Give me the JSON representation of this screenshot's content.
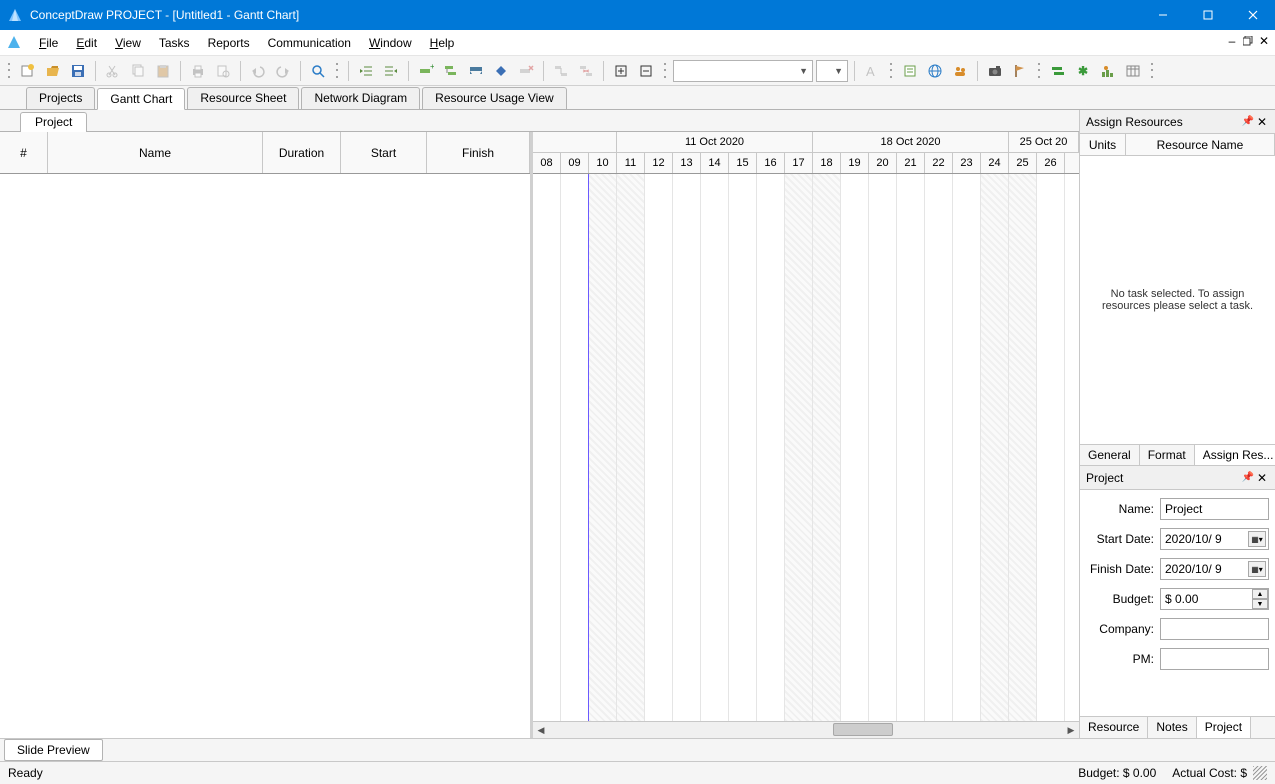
{
  "title": "ConceptDraw PROJECT - [Untitled1 - Gantt Chart]",
  "menu": {
    "file": "File",
    "edit": "Edit",
    "view": "View",
    "tasks": "Tasks",
    "reports": "Reports",
    "communication": "Communication",
    "window": "Window",
    "help": "Help"
  },
  "viewtabs": {
    "projects": "Projects",
    "gantt": "Gantt Chart",
    "resource_sheet": "Resource Sheet",
    "network": "Network Diagram",
    "resource_usage": "Resource Usage View"
  },
  "doc_tab": "Project",
  "gantt_cols": {
    "num": "#",
    "name": "Name",
    "duration": "Duration",
    "start": "Start",
    "finish": "Finish"
  },
  "weeks": [
    "11 Oct 2020",
    "18 Oct 2020",
    "25 Oct 20"
  ],
  "days": [
    "08",
    "09",
    "10",
    "11",
    "12",
    "13",
    "14",
    "15",
    "16",
    "17",
    "18",
    "19",
    "20",
    "21",
    "22",
    "23",
    "24",
    "25",
    "26"
  ],
  "assign": {
    "title": "Assign Resources",
    "units": "Units",
    "rname": "Resource Name",
    "empty": "No task selected. To assign resources please select a task."
  },
  "proptabs": {
    "general": "General",
    "format": "Format",
    "assign": "Assign Res..."
  },
  "project_panel": {
    "title": "Project",
    "name_label": "Name:",
    "name_value": "Project",
    "start_label": "Start Date:",
    "start_value": "2020/10/ 9",
    "finish_label": "Finish Date:",
    "finish_value": "2020/10/ 9",
    "budget_label": "Budget:",
    "budget_value": "$ 0.00",
    "company_label": "Company:",
    "company_value": "",
    "pm_label": "PM:",
    "pm_value": ""
  },
  "bottom_tabs": {
    "resource": "Resource",
    "notes": "Notes",
    "project": "Project"
  },
  "slide_preview": "Slide Preview",
  "status": {
    "ready": "Ready",
    "budget": "Budget: $ 0.00",
    "actual": "Actual Cost: $"
  }
}
